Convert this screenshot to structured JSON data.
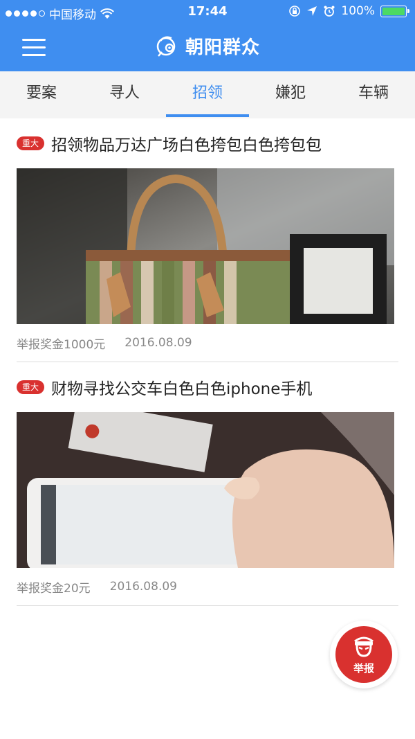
{
  "status_bar": {
    "carrier": "中国移动",
    "time": "17:44",
    "battery": "100%"
  },
  "header": {
    "title": "朝阳群众"
  },
  "tabs": [
    {
      "label": "要案"
    },
    {
      "label": "寻人"
    },
    {
      "label": "招领"
    },
    {
      "label": "嫌犯"
    },
    {
      "label": "车辆"
    }
  ],
  "active_tab": "招领",
  "feed": [
    {
      "badge": "重大",
      "title": "招领物品万达广场白色挎包白色挎包包",
      "reward": "举报奖金1000元",
      "date": "2016.08.09"
    },
    {
      "badge": "重大",
      "title": "财物寻找公交车白色白色iphone手机",
      "reward": "举报奖金20元",
      "date": "2016.08.09"
    }
  ],
  "fab": {
    "label": "举报"
  },
  "colors": {
    "primary": "#3f8ef0",
    "badge": "#d9312f",
    "tab_bg": "#f4f4f4"
  }
}
